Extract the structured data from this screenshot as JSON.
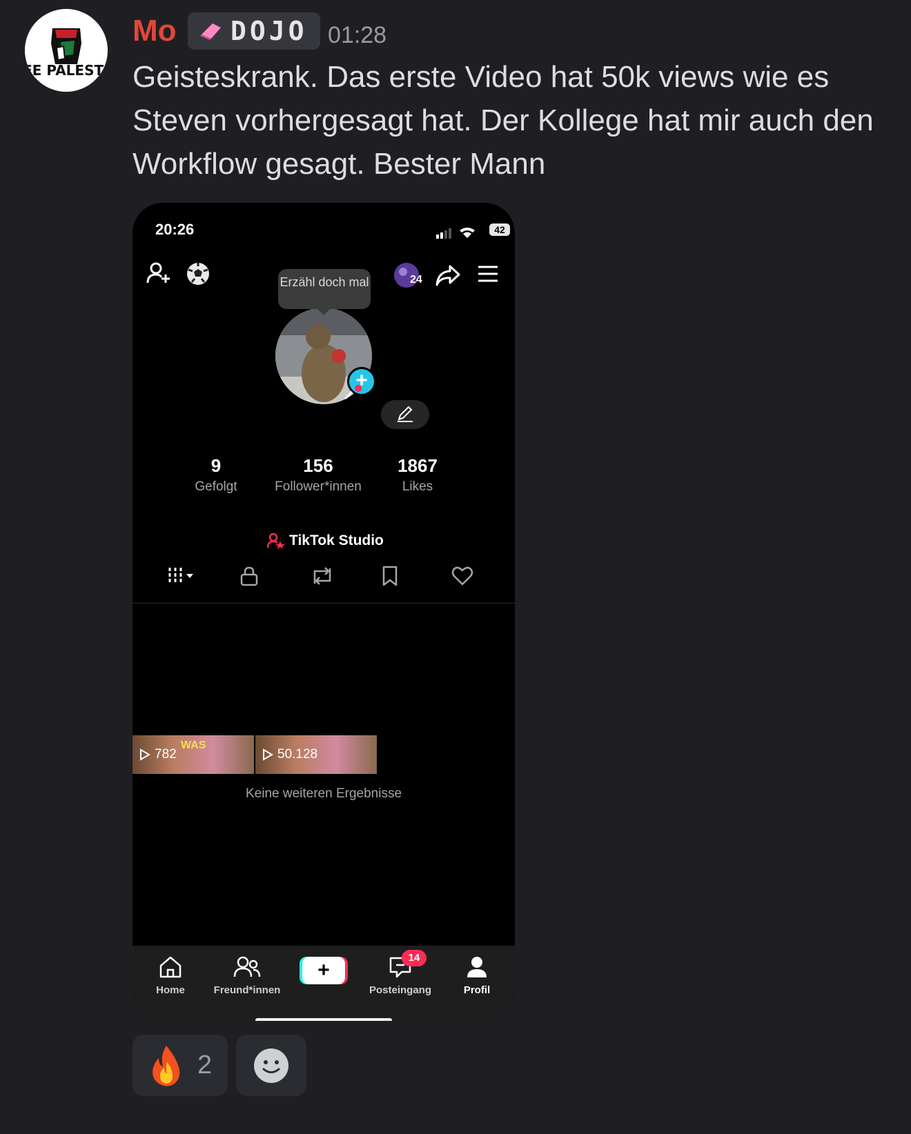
{
  "message": {
    "author": "Mo",
    "role_tag": "DOJO",
    "timestamp": "01:28",
    "text": "Geisteskrank. Das erste Video hat 50k views wie es Steven vorhergesagt hat. Der Kollege hat mir auch den Workflow gesagt. Bester Mann",
    "avatar_text": "FREE PALESTINE",
    "author_color": "#e1473a"
  },
  "phone": {
    "status_time": "20:26",
    "battery": "42",
    "coin_count": "24",
    "tooltip": "Erzähl doch mal",
    "stats": [
      {
        "value": "9",
        "label": "Gefolgt"
      },
      {
        "value": "156",
        "label": "Follower*innen"
      },
      {
        "value": "1867",
        "label": "Likes"
      }
    ],
    "studio_label": "TikTok Studio",
    "videos": [
      {
        "views": "782",
        "overlay": "WAS"
      },
      {
        "views": "50.128"
      }
    ],
    "no_more": "Keine weiteren Ergebnisse",
    "nav": {
      "home": "Home",
      "friends": "Freund*innen",
      "inbox": "Posteingang",
      "inbox_badge": "14",
      "profile": "Profil"
    },
    "accent": "#fe2c55"
  },
  "reactions": [
    {
      "emoji": "fire",
      "count": "2"
    },
    {
      "emoji": "add-reaction"
    }
  ]
}
